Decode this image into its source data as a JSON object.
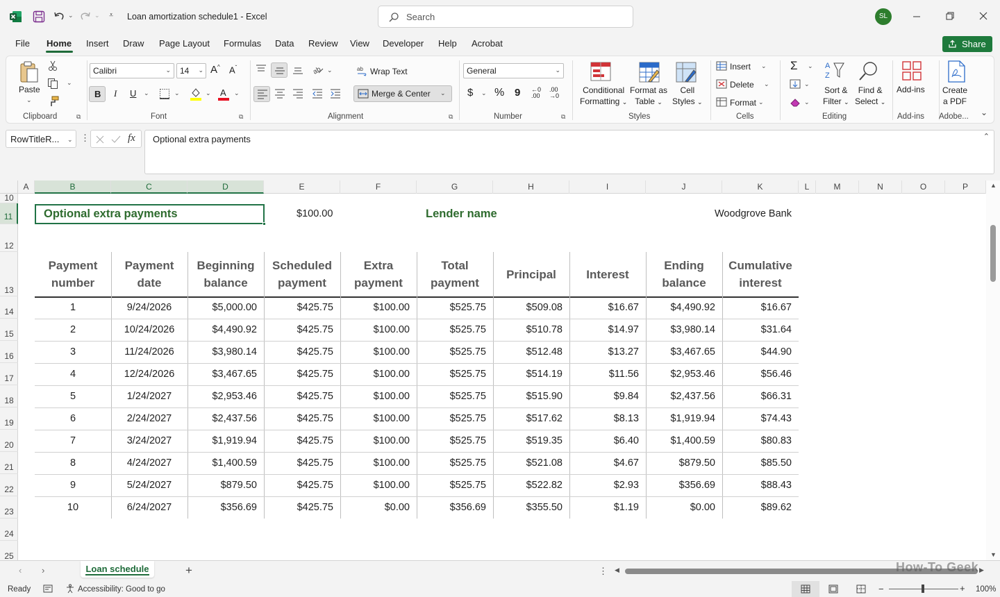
{
  "titlebar": {
    "doc_title": "Loan amortization schedule1",
    "app_separator": "-",
    "app_name": "Excel",
    "search_placeholder": "Search",
    "avatar_initials": "SL",
    "avatar_color": "#2d7d2d"
  },
  "menu": {
    "items": [
      "File",
      "Home",
      "Insert",
      "Draw",
      "Page Layout",
      "Formulas",
      "Data",
      "Review",
      "View",
      "Developer",
      "Help",
      "Acrobat"
    ],
    "active": "Home",
    "share_label": "Share",
    "share_color": "#1e7a3c"
  },
  "ribbon": {
    "clipboard": {
      "paste": "Paste",
      "label": "Clipboard"
    },
    "font": {
      "family": "Calibri",
      "size": "14",
      "bold": "B",
      "italic": "I",
      "underline": "U",
      "label": "Font"
    },
    "alignment": {
      "wrap_text": "Wrap Text",
      "merge_center": "Merge & Center",
      "label": "Alignment"
    },
    "number": {
      "format": "General",
      "currency": "$",
      "percent": "%",
      "comma": "9",
      "label": "Number"
    },
    "styles": {
      "conditional": "Conditional",
      "conditional2": "Formatting",
      "format_table": "Format as",
      "format_table2": "Table",
      "cell_styles": "Cell",
      "cell_styles2": "Styles",
      "label": "Styles"
    },
    "cells": {
      "insert": "Insert",
      "delete": "Delete",
      "format": "Format",
      "label": "Cells"
    },
    "editing": {
      "sort": "Sort &",
      "sort2": "Filter",
      "find": "Find &",
      "find2": "Select",
      "label": "Editing"
    },
    "addins": {
      "addins": "Add-ins",
      "label": "Add-ins"
    },
    "adobe": {
      "create": "Create",
      "create2": "a PDF",
      "label": "Adobe..."
    }
  },
  "formula_bar": {
    "name_box": "RowTitleR...",
    "fx": "fx",
    "content": "Optional extra payments"
  },
  "columns": [
    "A",
    "B",
    "C",
    "D",
    "E",
    "F",
    "G",
    "H",
    "I",
    "J",
    "K",
    "L",
    "M",
    "N",
    "O",
    "P"
  ],
  "rows": [
    "10",
    "11",
    "12",
    "13",
    "14",
    "15",
    "16",
    "17",
    "18",
    "19",
    "20",
    "21",
    "22",
    "23",
    "24",
    "25"
  ],
  "sheet": {
    "extra_label": "Optional extra payments",
    "extra_value": "$100.00",
    "lender_label": "Lender name",
    "lender_value": "Woodgrove Bank",
    "accent_color": "#2e6b2e",
    "headers": [
      [
        "Payment",
        "number"
      ],
      [
        "Payment",
        "date"
      ],
      [
        "Beginning",
        "balance"
      ],
      [
        "Scheduled",
        "payment"
      ],
      [
        "Extra",
        "payment"
      ],
      [
        "Total",
        "payment"
      ],
      [
        "Principal",
        ""
      ],
      [
        "Interest",
        ""
      ],
      [
        "Ending",
        "balance"
      ],
      [
        "Cumulative",
        "interest"
      ]
    ],
    "data": [
      [
        "1",
        "9/24/2026",
        "$5,000.00",
        "$425.75",
        "$100.00",
        "$525.75",
        "$509.08",
        "$16.67",
        "$4,490.92",
        "$16.67"
      ],
      [
        "2",
        "10/24/2026",
        "$4,490.92",
        "$425.75",
        "$100.00",
        "$525.75",
        "$510.78",
        "$14.97",
        "$3,980.14",
        "$31.64"
      ],
      [
        "3",
        "11/24/2026",
        "$3,980.14",
        "$425.75",
        "$100.00",
        "$525.75",
        "$512.48",
        "$13.27",
        "$3,467.65",
        "$44.90"
      ],
      [
        "4",
        "12/24/2026",
        "$3,467.65",
        "$425.75",
        "$100.00",
        "$525.75",
        "$514.19",
        "$11.56",
        "$2,953.46",
        "$56.46"
      ],
      [
        "5",
        "1/24/2027",
        "$2,953.46",
        "$425.75",
        "$100.00",
        "$525.75",
        "$515.90",
        "$9.84",
        "$2,437.56",
        "$66.31"
      ],
      [
        "6",
        "2/24/2027",
        "$2,437.56",
        "$425.75",
        "$100.00",
        "$525.75",
        "$517.62",
        "$8.13",
        "$1,919.94",
        "$74.43"
      ],
      [
        "7",
        "3/24/2027",
        "$1,919.94",
        "$425.75",
        "$100.00",
        "$525.75",
        "$519.35",
        "$6.40",
        "$1,400.59",
        "$80.83"
      ],
      [
        "8",
        "4/24/2027",
        "$1,400.59",
        "$425.75",
        "$100.00",
        "$525.75",
        "$521.08",
        "$4.67",
        "$879.50",
        "$85.50"
      ],
      [
        "9",
        "5/24/2027",
        "$879.50",
        "$425.75",
        "$100.00",
        "$525.75",
        "$522.82",
        "$2.93",
        "$356.69",
        "$88.43"
      ],
      [
        "10",
        "6/24/2027",
        "$356.69",
        "$425.75",
        "$0.00",
        "$356.69",
        "$355.50",
        "$1.19",
        "$0.00",
        "$89.62"
      ]
    ]
  },
  "tabs": {
    "sheet_name": "Loan schedule",
    "add": "+"
  },
  "status": {
    "ready": "Ready",
    "accessibility": "Accessibility: Good to go",
    "zoom": "100%",
    "minus": "−",
    "plus": "+",
    "watermark": "How-To Geek"
  }
}
